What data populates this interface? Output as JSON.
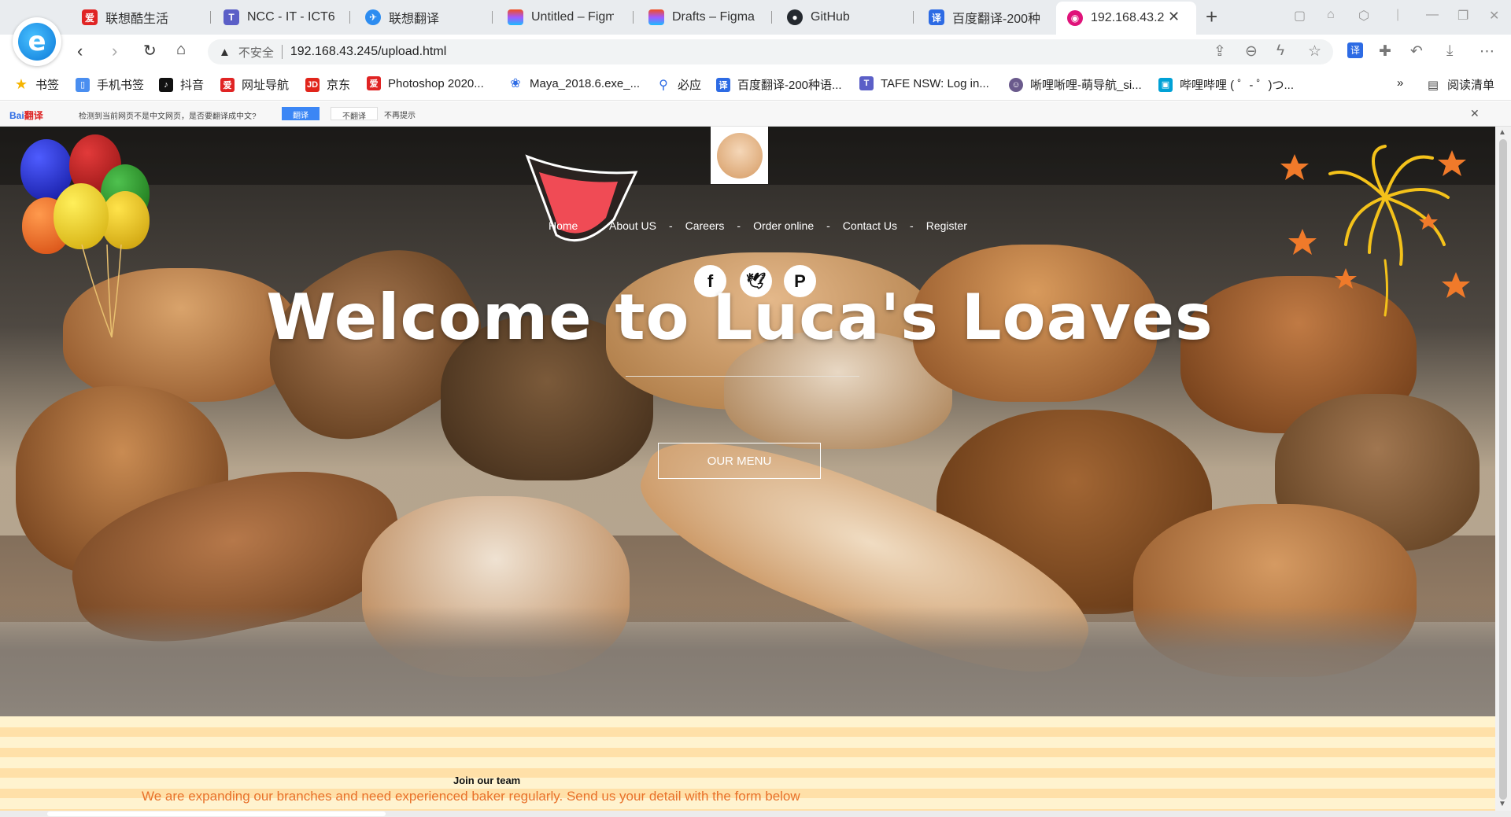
{
  "browser": {
    "tabs": [
      {
        "title": "联想酷生活",
        "icon": "lenovo-icon",
        "color": "#e02424"
      },
      {
        "title": "NCC - IT - ICT6",
        "icon": "teams-icon",
        "color": "#5b5fc7"
      },
      {
        "title": "联想翻译",
        "icon": "translate-bird-icon",
        "color": "#2d8cf0"
      },
      {
        "title": "Untitled – Figm",
        "icon": "figma-icon",
        "color": "#f24e1e"
      },
      {
        "title": "Drafts – Figma",
        "icon": "figma-icon",
        "color": "#a259ff"
      },
      {
        "title": "GitHub",
        "icon": "github-icon",
        "color": "#24292f"
      },
      {
        "title": "百度翻译-200种",
        "icon": "baidu-translate-icon",
        "color": "#2d6be4"
      },
      {
        "title": "192.168.43.2",
        "icon": "page-icon",
        "color": "#e0137a"
      }
    ],
    "new_tab": "+",
    "insecure_label": "不安全",
    "url": "192.168.43.245/upload.html",
    "bookmarks": [
      {
        "label": "书签",
        "icon": "star-icon",
        "color": "#f5b400"
      },
      {
        "label": "手机书签",
        "icon": "phone-icon",
        "color": "#4a8ef0"
      },
      {
        "label": "抖音",
        "icon": "tiktok-icon",
        "color": "#111111"
      },
      {
        "label": "网址导航",
        "icon": "lenovo-icon",
        "color": "#e02424"
      },
      {
        "label": "京东",
        "icon": "jd-icon",
        "color": "#e1251b"
      },
      {
        "label": "Photoshop 2020...",
        "icon": "photoshop-icon",
        "color": "#e02424"
      },
      {
        "label": "Maya_2018.6.exe_...",
        "icon": "baidu-paw-icon",
        "color": "#2d6be4"
      },
      {
        "label": "必应",
        "icon": "search-icon",
        "color": "#2d6be4"
      },
      {
        "label": "百度翻译-200种语...",
        "icon": "baidu-translate-icon",
        "color": "#2d6be4"
      },
      {
        "label": "TAFE NSW: Log in...",
        "icon": "teams-icon",
        "color": "#5b5fc7"
      },
      {
        "label": "唽哩唽哩-萌导航_si...",
        "icon": "anime-icon",
        "color": "#6a5a8c"
      },
      {
        "label": "哔哩哔哩 ( ゜- ゜)つ...",
        "icon": "bilibili-icon",
        "color": "#00a1d6"
      }
    ],
    "more_bookmarks": "»",
    "reading_list": "阅读清单"
  },
  "translate_bar": {
    "logo_a": "Bai",
    "logo_b": "翻译",
    "message": "检测到当前网页不是中文网页，是否要翻译成中文?",
    "translate": "翻译",
    "dont_translate": "不翻译",
    "no_remind": "不再提示"
  },
  "site": {
    "nav": [
      "Home",
      "About US",
      "Careers",
      "Order online",
      "Contact Us",
      "Register"
    ],
    "nav_separator": "-",
    "hero_title": "Welcome to Luca's Loaves",
    "menu_button": "OUR MENU",
    "social": [
      "facebook-icon",
      "twitter-icon",
      "pinterest-icon"
    ],
    "join_title": "Join our team",
    "join_text": "We are expanding our branches and need experienced baker regularly. Send us your detail with the form below",
    "accent_color": "#e8712a"
  }
}
